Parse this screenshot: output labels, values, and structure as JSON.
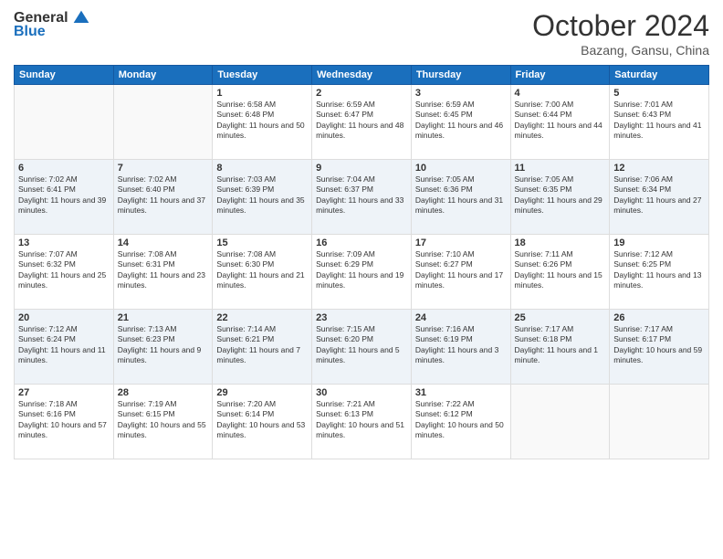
{
  "logo": {
    "general": "General",
    "blue": "Blue"
  },
  "header": {
    "month": "October 2024",
    "location": "Bazang, Gansu, China"
  },
  "weekdays": [
    "Sunday",
    "Monday",
    "Tuesday",
    "Wednesday",
    "Thursday",
    "Friday",
    "Saturday"
  ],
  "weeks": [
    [
      {
        "day": "",
        "info": ""
      },
      {
        "day": "",
        "info": ""
      },
      {
        "day": "1",
        "info": "Sunrise: 6:58 AM\nSunset: 6:48 PM\nDaylight: 11 hours and 50 minutes."
      },
      {
        "day": "2",
        "info": "Sunrise: 6:59 AM\nSunset: 6:47 PM\nDaylight: 11 hours and 48 minutes."
      },
      {
        "day": "3",
        "info": "Sunrise: 6:59 AM\nSunset: 6:45 PM\nDaylight: 11 hours and 46 minutes."
      },
      {
        "day": "4",
        "info": "Sunrise: 7:00 AM\nSunset: 6:44 PM\nDaylight: 11 hours and 44 minutes."
      },
      {
        "day": "5",
        "info": "Sunrise: 7:01 AM\nSunset: 6:43 PM\nDaylight: 11 hours and 41 minutes."
      }
    ],
    [
      {
        "day": "6",
        "info": "Sunrise: 7:02 AM\nSunset: 6:41 PM\nDaylight: 11 hours and 39 minutes."
      },
      {
        "day": "7",
        "info": "Sunrise: 7:02 AM\nSunset: 6:40 PM\nDaylight: 11 hours and 37 minutes."
      },
      {
        "day": "8",
        "info": "Sunrise: 7:03 AM\nSunset: 6:39 PM\nDaylight: 11 hours and 35 minutes."
      },
      {
        "day": "9",
        "info": "Sunrise: 7:04 AM\nSunset: 6:37 PM\nDaylight: 11 hours and 33 minutes."
      },
      {
        "day": "10",
        "info": "Sunrise: 7:05 AM\nSunset: 6:36 PM\nDaylight: 11 hours and 31 minutes."
      },
      {
        "day": "11",
        "info": "Sunrise: 7:05 AM\nSunset: 6:35 PM\nDaylight: 11 hours and 29 minutes."
      },
      {
        "day": "12",
        "info": "Sunrise: 7:06 AM\nSunset: 6:34 PM\nDaylight: 11 hours and 27 minutes."
      }
    ],
    [
      {
        "day": "13",
        "info": "Sunrise: 7:07 AM\nSunset: 6:32 PM\nDaylight: 11 hours and 25 minutes."
      },
      {
        "day": "14",
        "info": "Sunrise: 7:08 AM\nSunset: 6:31 PM\nDaylight: 11 hours and 23 minutes."
      },
      {
        "day": "15",
        "info": "Sunrise: 7:08 AM\nSunset: 6:30 PM\nDaylight: 11 hours and 21 minutes."
      },
      {
        "day": "16",
        "info": "Sunrise: 7:09 AM\nSunset: 6:29 PM\nDaylight: 11 hours and 19 minutes."
      },
      {
        "day": "17",
        "info": "Sunrise: 7:10 AM\nSunset: 6:27 PM\nDaylight: 11 hours and 17 minutes."
      },
      {
        "day": "18",
        "info": "Sunrise: 7:11 AM\nSunset: 6:26 PM\nDaylight: 11 hours and 15 minutes."
      },
      {
        "day": "19",
        "info": "Sunrise: 7:12 AM\nSunset: 6:25 PM\nDaylight: 11 hours and 13 minutes."
      }
    ],
    [
      {
        "day": "20",
        "info": "Sunrise: 7:12 AM\nSunset: 6:24 PM\nDaylight: 11 hours and 11 minutes."
      },
      {
        "day": "21",
        "info": "Sunrise: 7:13 AM\nSunset: 6:23 PM\nDaylight: 11 hours and 9 minutes."
      },
      {
        "day": "22",
        "info": "Sunrise: 7:14 AM\nSunset: 6:21 PM\nDaylight: 11 hours and 7 minutes."
      },
      {
        "day": "23",
        "info": "Sunrise: 7:15 AM\nSunset: 6:20 PM\nDaylight: 11 hours and 5 minutes."
      },
      {
        "day": "24",
        "info": "Sunrise: 7:16 AM\nSunset: 6:19 PM\nDaylight: 11 hours and 3 minutes."
      },
      {
        "day": "25",
        "info": "Sunrise: 7:17 AM\nSunset: 6:18 PM\nDaylight: 11 hours and 1 minute."
      },
      {
        "day": "26",
        "info": "Sunrise: 7:17 AM\nSunset: 6:17 PM\nDaylight: 10 hours and 59 minutes."
      }
    ],
    [
      {
        "day": "27",
        "info": "Sunrise: 7:18 AM\nSunset: 6:16 PM\nDaylight: 10 hours and 57 minutes."
      },
      {
        "day": "28",
        "info": "Sunrise: 7:19 AM\nSunset: 6:15 PM\nDaylight: 10 hours and 55 minutes."
      },
      {
        "day": "29",
        "info": "Sunrise: 7:20 AM\nSunset: 6:14 PM\nDaylight: 10 hours and 53 minutes."
      },
      {
        "day": "30",
        "info": "Sunrise: 7:21 AM\nSunset: 6:13 PM\nDaylight: 10 hours and 51 minutes."
      },
      {
        "day": "31",
        "info": "Sunrise: 7:22 AM\nSunset: 6:12 PM\nDaylight: 10 hours and 50 minutes."
      },
      {
        "day": "",
        "info": ""
      },
      {
        "day": "",
        "info": ""
      }
    ]
  ]
}
